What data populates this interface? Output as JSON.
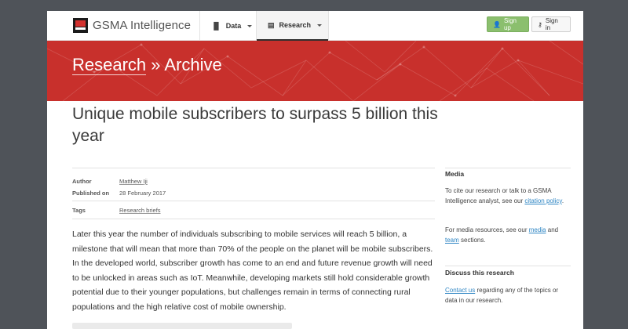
{
  "header": {
    "brand": "GSMA Intelligence",
    "logo_text": "GSMA",
    "nav": [
      {
        "label": "Data",
        "icon": "bar-chart-icon"
      },
      {
        "label": "Research",
        "icon": "document-icon"
      }
    ],
    "signup_label": "Sign up",
    "signin_label": "Sign in"
  },
  "banner": {
    "crumb_link": "Research",
    "crumb_sep": " » ",
    "crumb_current": "Archive"
  },
  "article": {
    "title": "Unique mobile subscribers to surpass 5 billion this year",
    "meta": {
      "author_label": "Author",
      "author": "Matthew Iji",
      "published_label": "Published on",
      "published": "28 February 2017",
      "tags_label": "Tags",
      "tag": "Research briefs"
    },
    "body": "Later this year the number of individuals subscribing to mobile services will reach 5 billion, a milestone that will mean that more than 70% of the people on the planet will be mobile subscribers. In the developed world, subscriber growth has come to an end and future revenue growth will need to be unlocked in areas such as IoT. Meanwhile, developing markets still hold considerable growth potential due to their younger populations, but challenges remain in terms of connecting rural populations and the high relative cost of mobile ownership."
  },
  "sidebar": {
    "media_title": "Media",
    "media_p1_a": "To cite our research or talk to a GSMA Intelligence analyst, see our ",
    "media_p1_link": "citation policy",
    "media_p1_b": ".",
    "media_p2_a": "For media resources, see our ",
    "media_p2_link1": "media",
    "media_p2_mid": " and ",
    "media_p2_link2": "team",
    "media_p2_b": " sections.",
    "discuss_title": "Discuss this research",
    "discuss_link": "Contact us",
    "discuss_text": " regarding any of the topics or data in our research."
  },
  "colors": {
    "banner_red": "#c8302c",
    "signup_green": "#8bbf6e",
    "link_blue": "#2f86c4",
    "page_bg": "#4f5359"
  }
}
